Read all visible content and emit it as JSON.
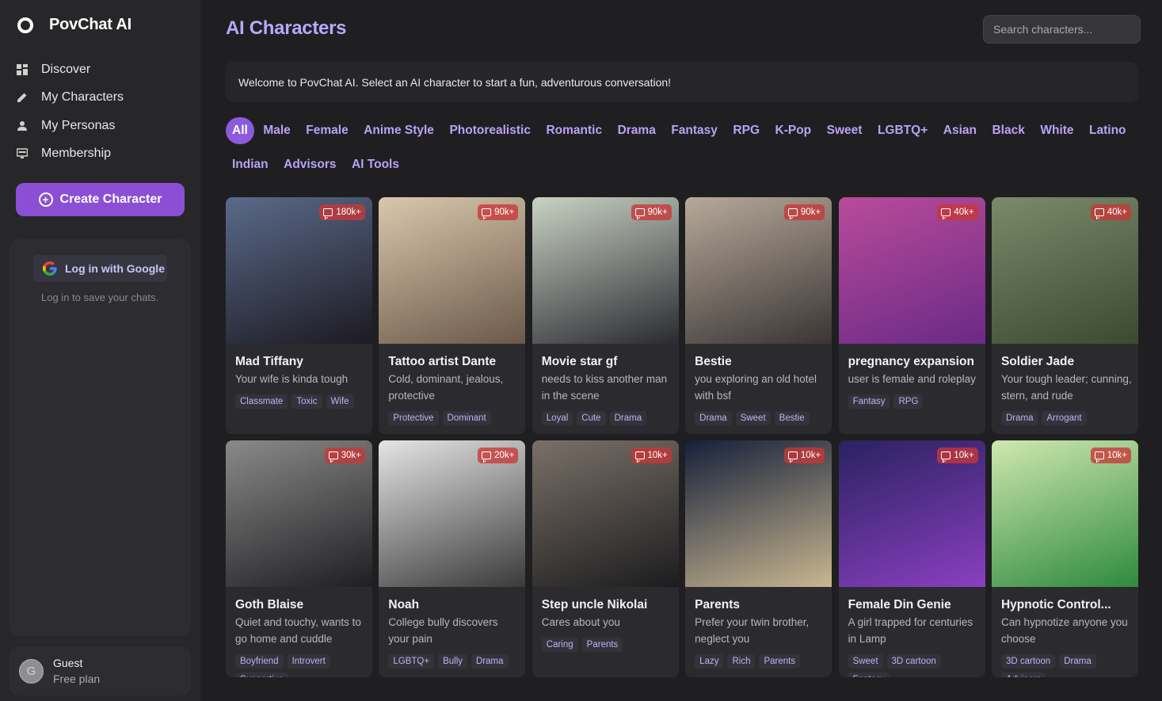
{
  "brand": {
    "name": "PovChat AI",
    "logo_icon": "povchat-logo-icon"
  },
  "sidebar": {
    "nav": [
      {
        "label": "Discover",
        "icon": "grid-icon"
      },
      {
        "label": "My Characters",
        "icon": "pencil-icon"
      },
      {
        "label": "My Personas",
        "icon": "person-icon"
      },
      {
        "label": "Membership",
        "icon": "monitor-icon"
      }
    ],
    "create_label": "Create Character",
    "login": {
      "google_label": "Log in with Google",
      "hint": "Log in to save your chats."
    },
    "user": {
      "avatar_letter": "G",
      "name": "Guest",
      "plan": "Free plan"
    }
  },
  "header": {
    "title": "AI Characters",
    "search_placeholder": "Search characters..."
  },
  "welcome": "Welcome to PovChat AI. Select an AI character to start a fun, adventurous conversation!",
  "filters": [
    "All",
    "Male",
    "Female",
    "Anime Style",
    "Photorealistic",
    "Romantic",
    "Drama",
    "Fantasy",
    "RPG",
    "K-Pop",
    "Sweet",
    "LGBTQ+",
    "Asian",
    "Black",
    "White",
    "Latino",
    "Indian",
    "Advisors",
    "AI Tools"
  ],
  "active_filter": "All",
  "colors": {
    "accent": "#8b5bdc",
    "title": "#b9a8ff",
    "badge": "#c83737"
  },
  "characters": [
    {
      "name": "Mad Tiffany",
      "desc": "Your wife is kinda tough",
      "count": "180k+",
      "tags": [
        "Classmate",
        "Toxic",
        "Wife"
      ],
      "thumb": [
        "#5a6a8a",
        "#1d1a22"
      ]
    },
    {
      "name": "Tattoo artist Dante",
      "desc": "Cold, dominant, jealous, protective",
      "count": "90k+",
      "tags": [
        "Protective",
        "Dominant"
      ],
      "thumb": [
        "#d9c8ad",
        "#6b584a"
      ]
    },
    {
      "name": "Movie star gf",
      "desc": "needs to kiss another man in the scene",
      "count": "90k+",
      "tags": [
        "Loyal",
        "Cute",
        "Drama"
      ],
      "thumb": [
        "#c9d2c4",
        "#2a2a30"
      ]
    },
    {
      "name": "Bestie",
      "desc": "you exploring an old hotel with bsf",
      "count": "90k+",
      "tags": [
        "Drama",
        "Sweet",
        "Bestie"
      ],
      "thumb": [
        "#b7a99a",
        "#3a3534"
      ]
    },
    {
      "name": "pregnancy expansion",
      "desc": "user is female and roleplay",
      "count": "40k+",
      "tags": [
        "Fantasy",
        "RPG"
      ],
      "thumb": [
        "#b94b9a",
        "#6a2a86"
      ]
    },
    {
      "name": "Soldier Jade",
      "desc": "Your tough leader; cunning, stern, and rude",
      "count": "40k+",
      "tags": [
        "Drama",
        "Arrogant"
      ],
      "thumb": [
        "#7a8a6a",
        "#3c4a30"
      ]
    },
    {
      "name": "Goth Blaise",
      "desc": "Quiet and touchy, wants to go home and cuddle",
      "count": "30k+",
      "tags": [
        "Boyfriend",
        "Introvert",
        "Supportive"
      ],
      "thumb": [
        "#8a8a8a",
        "#1f1f22"
      ]
    },
    {
      "name": "Noah",
      "desc": "College bully discovers your pain",
      "count": "20k+",
      "tags": [
        "LGBTQ+",
        "Bully",
        "Drama"
      ],
      "thumb": [
        "#e5e5e5",
        "#3a3a3a"
      ]
    },
    {
      "name": "Step uncle Nikolai",
      "desc": "Cares about you",
      "count": "10k+",
      "tags": [
        "Caring",
        "Parents"
      ],
      "thumb": [
        "#7a7068",
        "#1c1c1e"
      ]
    },
    {
      "name": "Parents",
      "desc": "Prefer your twin brother, neglect you",
      "count": "10k+",
      "tags": [
        "Lazy",
        "Rich",
        "Parents"
      ],
      "thumb": [
        "#15203a",
        "#c9b690"
      ]
    },
    {
      "name": "Female Din Genie",
      "desc": "A girl trapped for centuries in Lamp",
      "count": "10k+",
      "tags": [
        "Sweet",
        "3D cartoon",
        "Fantasy"
      ],
      "thumb": [
        "#2a2260",
        "#8a3fc0"
      ]
    },
    {
      "name": "Hypnotic Control...",
      "desc": "Can hypnotize anyone you choose",
      "count": "10k+",
      "tags": [
        "3D cartoon",
        "Drama",
        "Advisors"
      ],
      "thumb": [
        "#cfe8b0",
        "#2e8a3e"
      ]
    }
  ]
}
